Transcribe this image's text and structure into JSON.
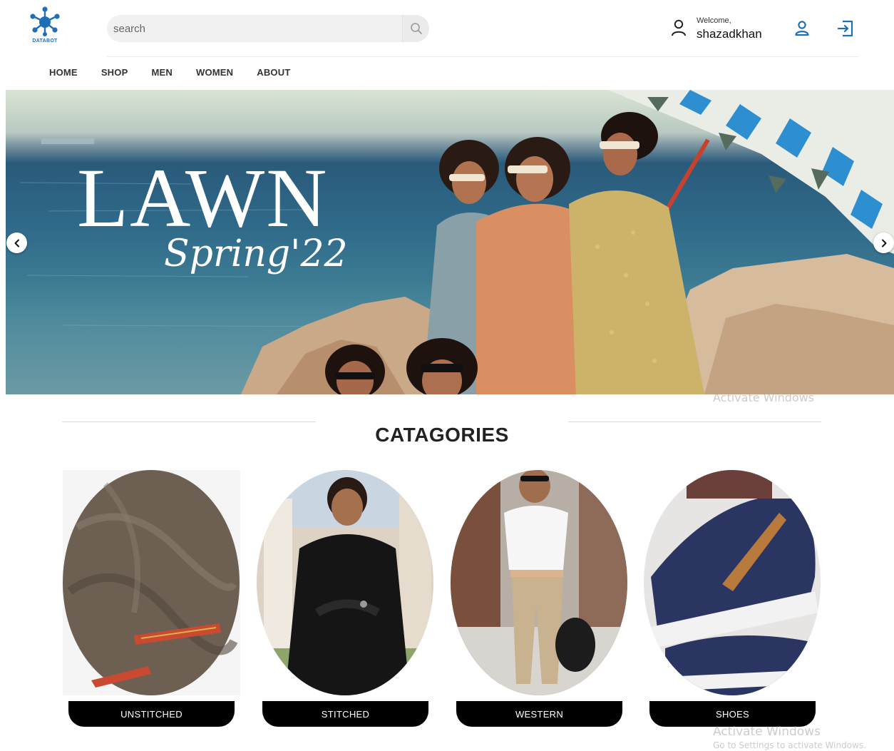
{
  "brand": {
    "name": "DATABOT",
    "color": "#1f6fb8"
  },
  "search": {
    "placeholder": "search",
    "icon": "search-icon"
  },
  "user": {
    "welcome": "Welcome,",
    "name": "shazadkhan"
  },
  "nav": {
    "items": [
      "HOME",
      "SHOP",
      "MEN",
      "WOMEN",
      "ABOUT"
    ]
  },
  "hero": {
    "title": "LAWN",
    "subtitle": "Spring'22"
  },
  "categories": {
    "title": "CATAGORIES",
    "items": [
      {
        "label": "UNSTITCHED"
      },
      {
        "label": "STITCHED"
      },
      {
        "label": "WESTERN"
      },
      {
        "label": "SHOES"
      }
    ]
  },
  "watermark": {
    "line1": "Activate Windows",
    "line2": "Go to Settings to activate Windows."
  }
}
